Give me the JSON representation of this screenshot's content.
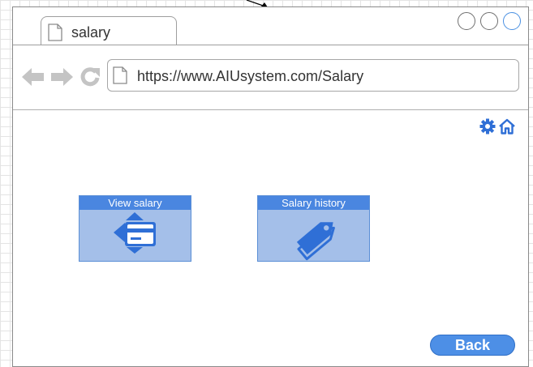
{
  "tab": {
    "title": "salary"
  },
  "address_bar": {
    "url": "https://www.AIUsystem.com/Salary"
  },
  "tiles": [
    {
      "label": "View salary",
      "icon": "credit-card-icon"
    },
    {
      "label": "Salary history",
      "icon": "tags-icon"
    }
  ],
  "buttons": {
    "back_label": "Back"
  },
  "colors": {
    "accent": "#4a86e0",
    "tile_fill": "#a4bfe9",
    "icon_blue": "#2f6fd6"
  }
}
